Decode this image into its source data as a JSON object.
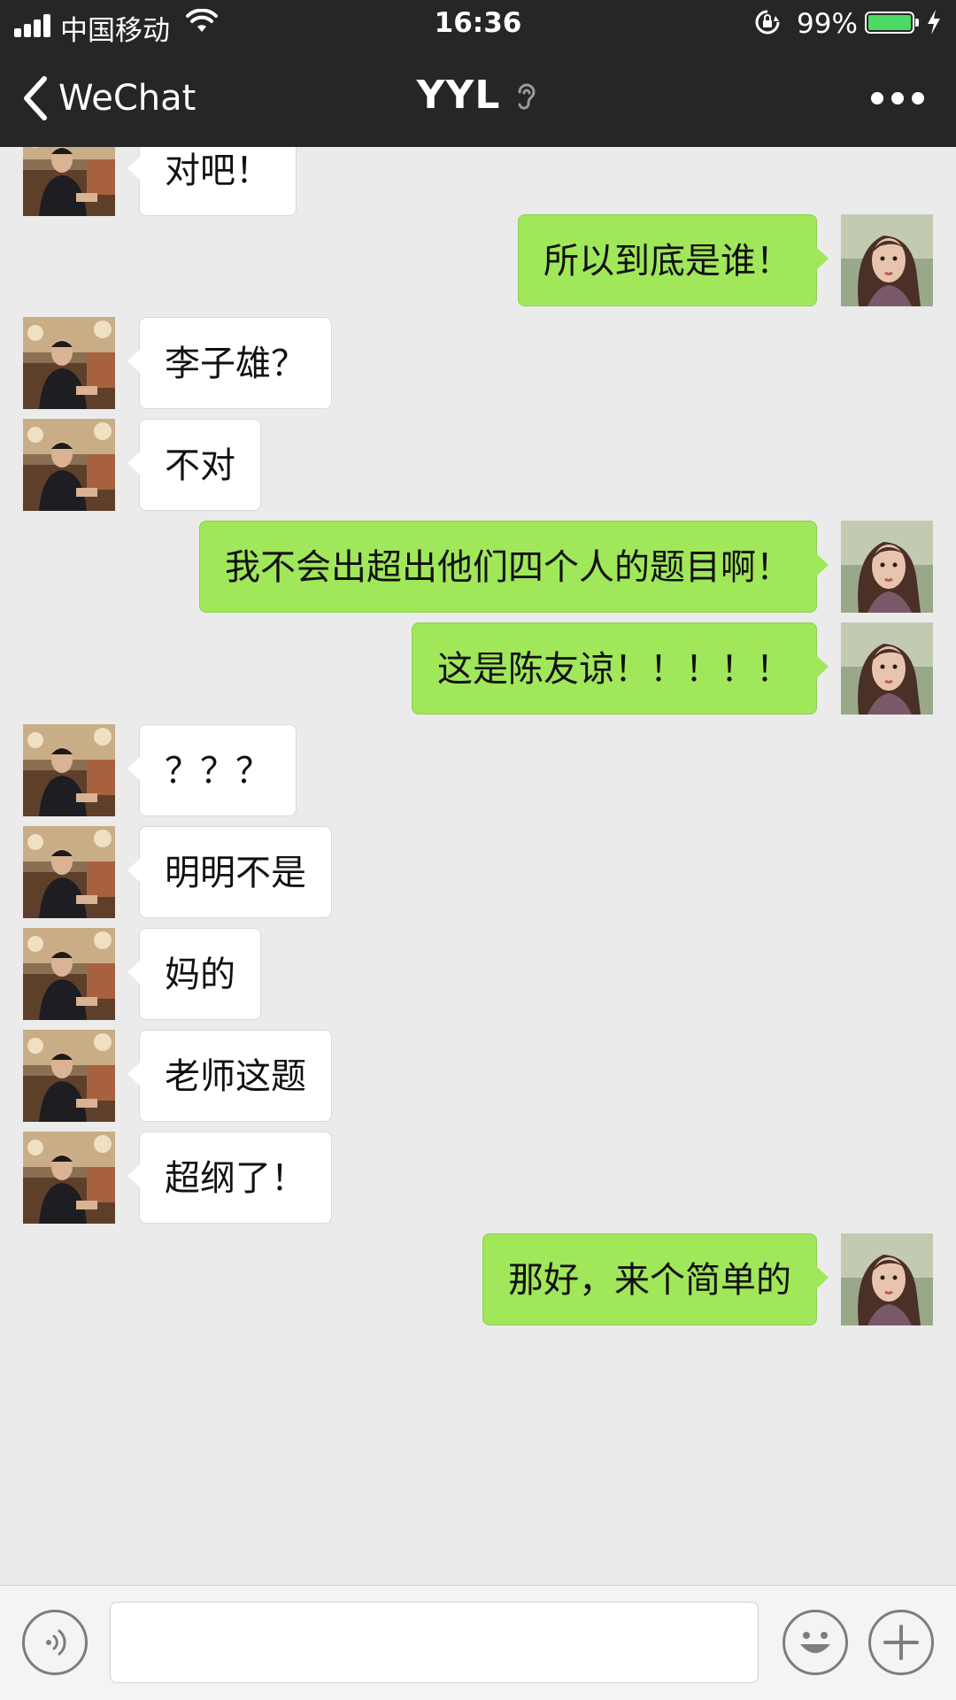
{
  "status_bar": {
    "carrier": "中国移动",
    "time": "16:36",
    "battery_percent": "99%",
    "battery_level": 0.99
  },
  "nav": {
    "back_label": "WeChat",
    "title": "YYL"
  },
  "messages": [
    {
      "side": "in",
      "text": "对吧！"
    },
    {
      "side": "out",
      "text": "所以到底是谁！"
    },
    {
      "side": "in",
      "text": "李子雄？"
    },
    {
      "side": "in",
      "text": "不对"
    },
    {
      "side": "out",
      "text": "我不会出超出他们四个人的题目啊！"
    },
    {
      "side": "out",
      "text": "这是陈友谅！！！！！"
    },
    {
      "side": "in",
      "text": "？？？"
    },
    {
      "side": "in",
      "text": "明明不是"
    },
    {
      "side": "in",
      "text": "妈的"
    },
    {
      "side": "in",
      "text": "老师这题"
    },
    {
      "side": "in",
      "text": "超纲了！"
    },
    {
      "side": "out",
      "text": "那好，来个简单的"
    }
  ],
  "input": {
    "value": ""
  },
  "colors": {
    "outgoing_bubble": "#a0e75a",
    "incoming_bubble": "#ffffff",
    "chat_background": "#ebebeb",
    "header": "#262628"
  },
  "icons": [
    "signal-icon",
    "wifi-icon",
    "rotation-lock-icon",
    "battery-icon",
    "charging-icon",
    "back-chevron-icon",
    "ear-icon",
    "more-icon",
    "voice-icon",
    "emoji-icon",
    "plus-icon"
  ]
}
